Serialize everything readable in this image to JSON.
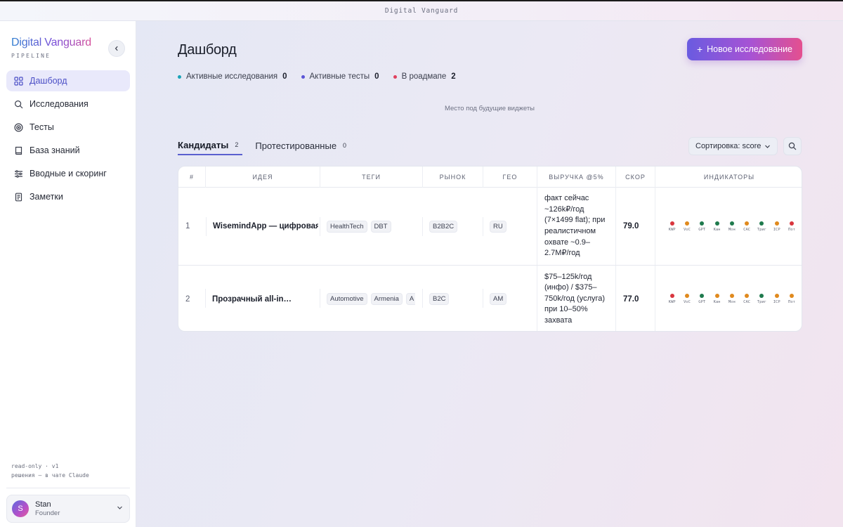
{
  "window": {
    "title": "Digital Vanguard"
  },
  "sidebar": {
    "brand": "Digital Vanguard",
    "brand_sub": "PIPELINE",
    "nav": [
      {
        "label": "Дашборд",
        "icon": "grid-icon",
        "active": true
      },
      {
        "label": "Исследования",
        "icon": "search-icon"
      },
      {
        "label": "Тесты",
        "icon": "target-icon"
      },
      {
        "label": "База знаний",
        "icon": "book-icon"
      },
      {
        "label": "Вводные и скоринг",
        "icon": "sliders-icon"
      },
      {
        "label": "Заметки",
        "icon": "note-icon"
      }
    ],
    "note_line1": "read-only · v1",
    "note_line2": "решения — в чате Claude",
    "user": {
      "initial": "S",
      "name": "Stan",
      "role": "Founder"
    }
  },
  "main": {
    "title": "Дашборд",
    "new_button": "Новое исследование",
    "stats": [
      {
        "label": "Активные исследования",
        "value": "0",
        "color": "#1aa3b8"
      },
      {
        "label": "Активные тесты",
        "value": "0",
        "color": "#5b55d6"
      },
      {
        "label": "В роадмапе",
        "value": "2",
        "color": "#e0405e"
      }
    ],
    "placeholder": "Место под будущие виджеты",
    "tabs": [
      {
        "label": "Кандидаты",
        "count": "2",
        "active": true
      },
      {
        "label": "Протестированные",
        "count": "0"
      }
    ],
    "sort_label": "Сортировка: score",
    "table": {
      "headers": [
        "#",
        "ИДЕЯ",
        "ТЕГИ",
        "РЫНОК",
        "ГЕО",
        "ВЫРУЧКА @5%",
        "СКОР",
        "ИНДИКАТОРЫ"
      ],
      "indicator_labels": [
        "KWP",
        "VoC",
        "GPT",
        "Кан",
        "Мон",
        "CAC",
        "Триг",
        "ICP",
        "Пот"
      ],
      "rows": [
        {
          "num": "1",
          "idea": "WisemindApp — цифровая…",
          "tags": [
            "HealthTech",
            "DBT"
          ],
          "market": "B2B2C",
          "geo": "RU",
          "revenue": "факт сейчас ~126k₽/год (7×1499 flat); при реалистичном охвате ~0.9–2.7M₽/год",
          "score": "79.0",
          "indicators": [
            "#d9363e",
            "#e08a1e",
            "#1f7a4d",
            "#1f7a4d",
            "#1f7a4d",
            "#e08a1e",
            "#1f7a4d",
            "#e08a1e",
            "#d9363e"
          ]
        },
        {
          "num": "2",
          "idea": "Прозрачный all-in…",
          "tags": [
            "Automotive",
            "Armenia",
            "A"
          ],
          "market": "B2C",
          "geo": "AM",
          "revenue": "$75–125k/год (инфо) / $375–750k/год (услуга) при 10–50% захвата",
          "score": "77.0",
          "indicators": [
            "#d9363e",
            "#e08a1e",
            "#1f7a4d",
            "#e08a1e",
            "#e08a1e",
            "#e08a1e",
            "#1f7a4d",
            "#e08a1e",
            "#e08a1e"
          ]
        }
      ]
    }
  }
}
